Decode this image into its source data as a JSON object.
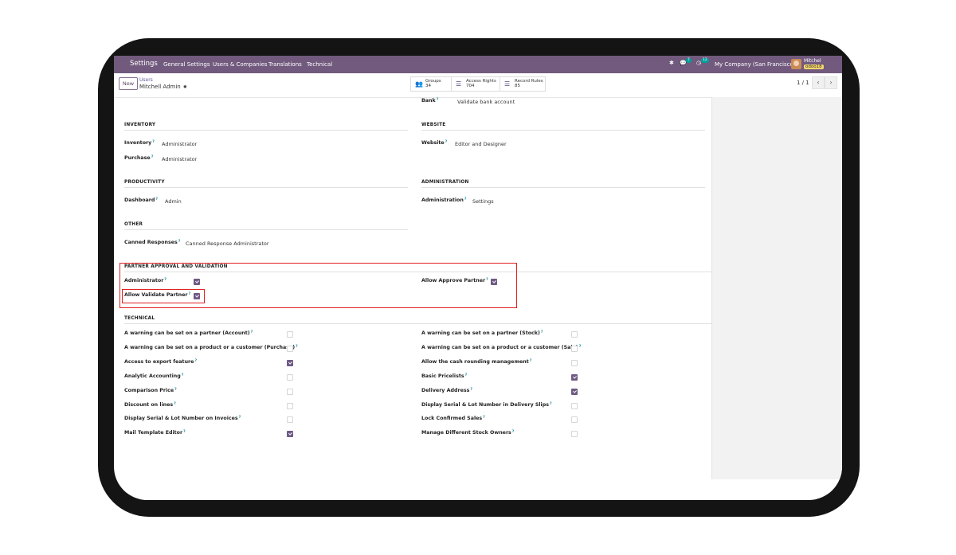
{
  "navbar": {
    "brand": "Settings",
    "menu": [
      "General Settings",
      "Users & Companies",
      "Translations",
      "Technical"
    ],
    "messages_count": "7",
    "activities_count": "12",
    "company": "My Company (San Francisco)",
    "user_name": "Mitchel",
    "db_name": "odoo18"
  },
  "control": {
    "new_label": "New",
    "breadcrumb_parent": "Users",
    "breadcrumb_current": "Mitchell Admin",
    "smart_buttons": [
      {
        "label": "Groups",
        "count": "34",
        "icon": "users-icon"
      },
      {
        "label": "Access Rights",
        "count": "704",
        "icon": "list-icon"
      },
      {
        "label": "Record Rules",
        "count": "85",
        "icon": "list-icon"
      }
    ],
    "pager": "1 / 1"
  },
  "form": {
    "bank": {
      "label": "Bank",
      "value": "Validate bank account"
    },
    "inventory": {
      "title": "INVENTORY",
      "fields": [
        {
          "label": "Inventory",
          "value": "Administrator"
        },
        {
          "label": "Purchase",
          "value": "Administrator"
        }
      ]
    },
    "website": {
      "title": "WEBSITE",
      "fields": [
        {
          "label": "Website",
          "value": "Editor and Designer"
        }
      ]
    },
    "productivity": {
      "title": "PRODUCTIVITY",
      "fields": [
        {
          "label": "Dashboard",
          "value": "Admin"
        }
      ]
    },
    "administration": {
      "title": "ADMINISTRATION",
      "fields": [
        {
          "label": "Administration",
          "value": "Settings"
        }
      ]
    },
    "other": {
      "title": "OTHER",
      "fields": [
        {
          "label": "Canned Responses",
          "value": "Canned Response Administrator"
        }
      ]
    },
    "partner_approval": {
      "title": "PARTNER APPROVAL AND VALIDATION",
      "administrator": {
        "label": "Administrator",
        "checked": true
      },
      "allow_validate": {
        "label": "Allow Validate Partner",
        "checked": true
      },
      "allow_approve": {
        "label": "Allow Approve Partner",
        "checked": true
      }
    },
    "technical": {
      "title": "TECHNICAL",
      "left": [
        {
          "label": "A warning can be set on a partner (Account)",
          "checked": false
        },
        {
          "label": "A warning can be set on a product or a customer (Purchase)",
          "checked": false
        },
        {
          "label": "Access to export feature",
          "checked": true
        },
        {
          "label": "Analytic Accounting",
          "checked": false
        },
        {
          "label": "Comparison Price",
          "checked": false
        },
        {
          "label": "Discount on lines",
          "checked": false
        },
        {
          "label": "Display Serial & Lot Number on Invoices",
          "checked": false
        },
        {
          "label": "Mail Template Editor",
          "checked": true
        }
      ],
      "right": [
        {
          "label": "A warning can be set on a partner (Stock)",
          "checked": false
        },
        {
          "label": "A warning can be set on a product or a customer (Sale)",
          "checked": false
        },
        {
          "label": "Allow the cash rounding management",
          "checked": false
        },
        {
          "label": "Basic Pricelists",
          "checked": true
        },
        {
          "label": "Delivery Address",
          "checked": true
        },
        {
          "label": "Display Serial & Lot Number in Delivery Slips",
          "checked": false
        },
        {
          "label": "Lock Confirmed Sales",
          "checked": false
        },
        {
          "label": "Manage Different Stock Owners",
          "checked": false
        }
      ]
    }
  },
  "colors": {
    "navbar": "#715a7d",
    "checkbox_on": "#6e5a84",
    "highlight": "#e02020",
    "help": "#1a8e99"
  }
}
